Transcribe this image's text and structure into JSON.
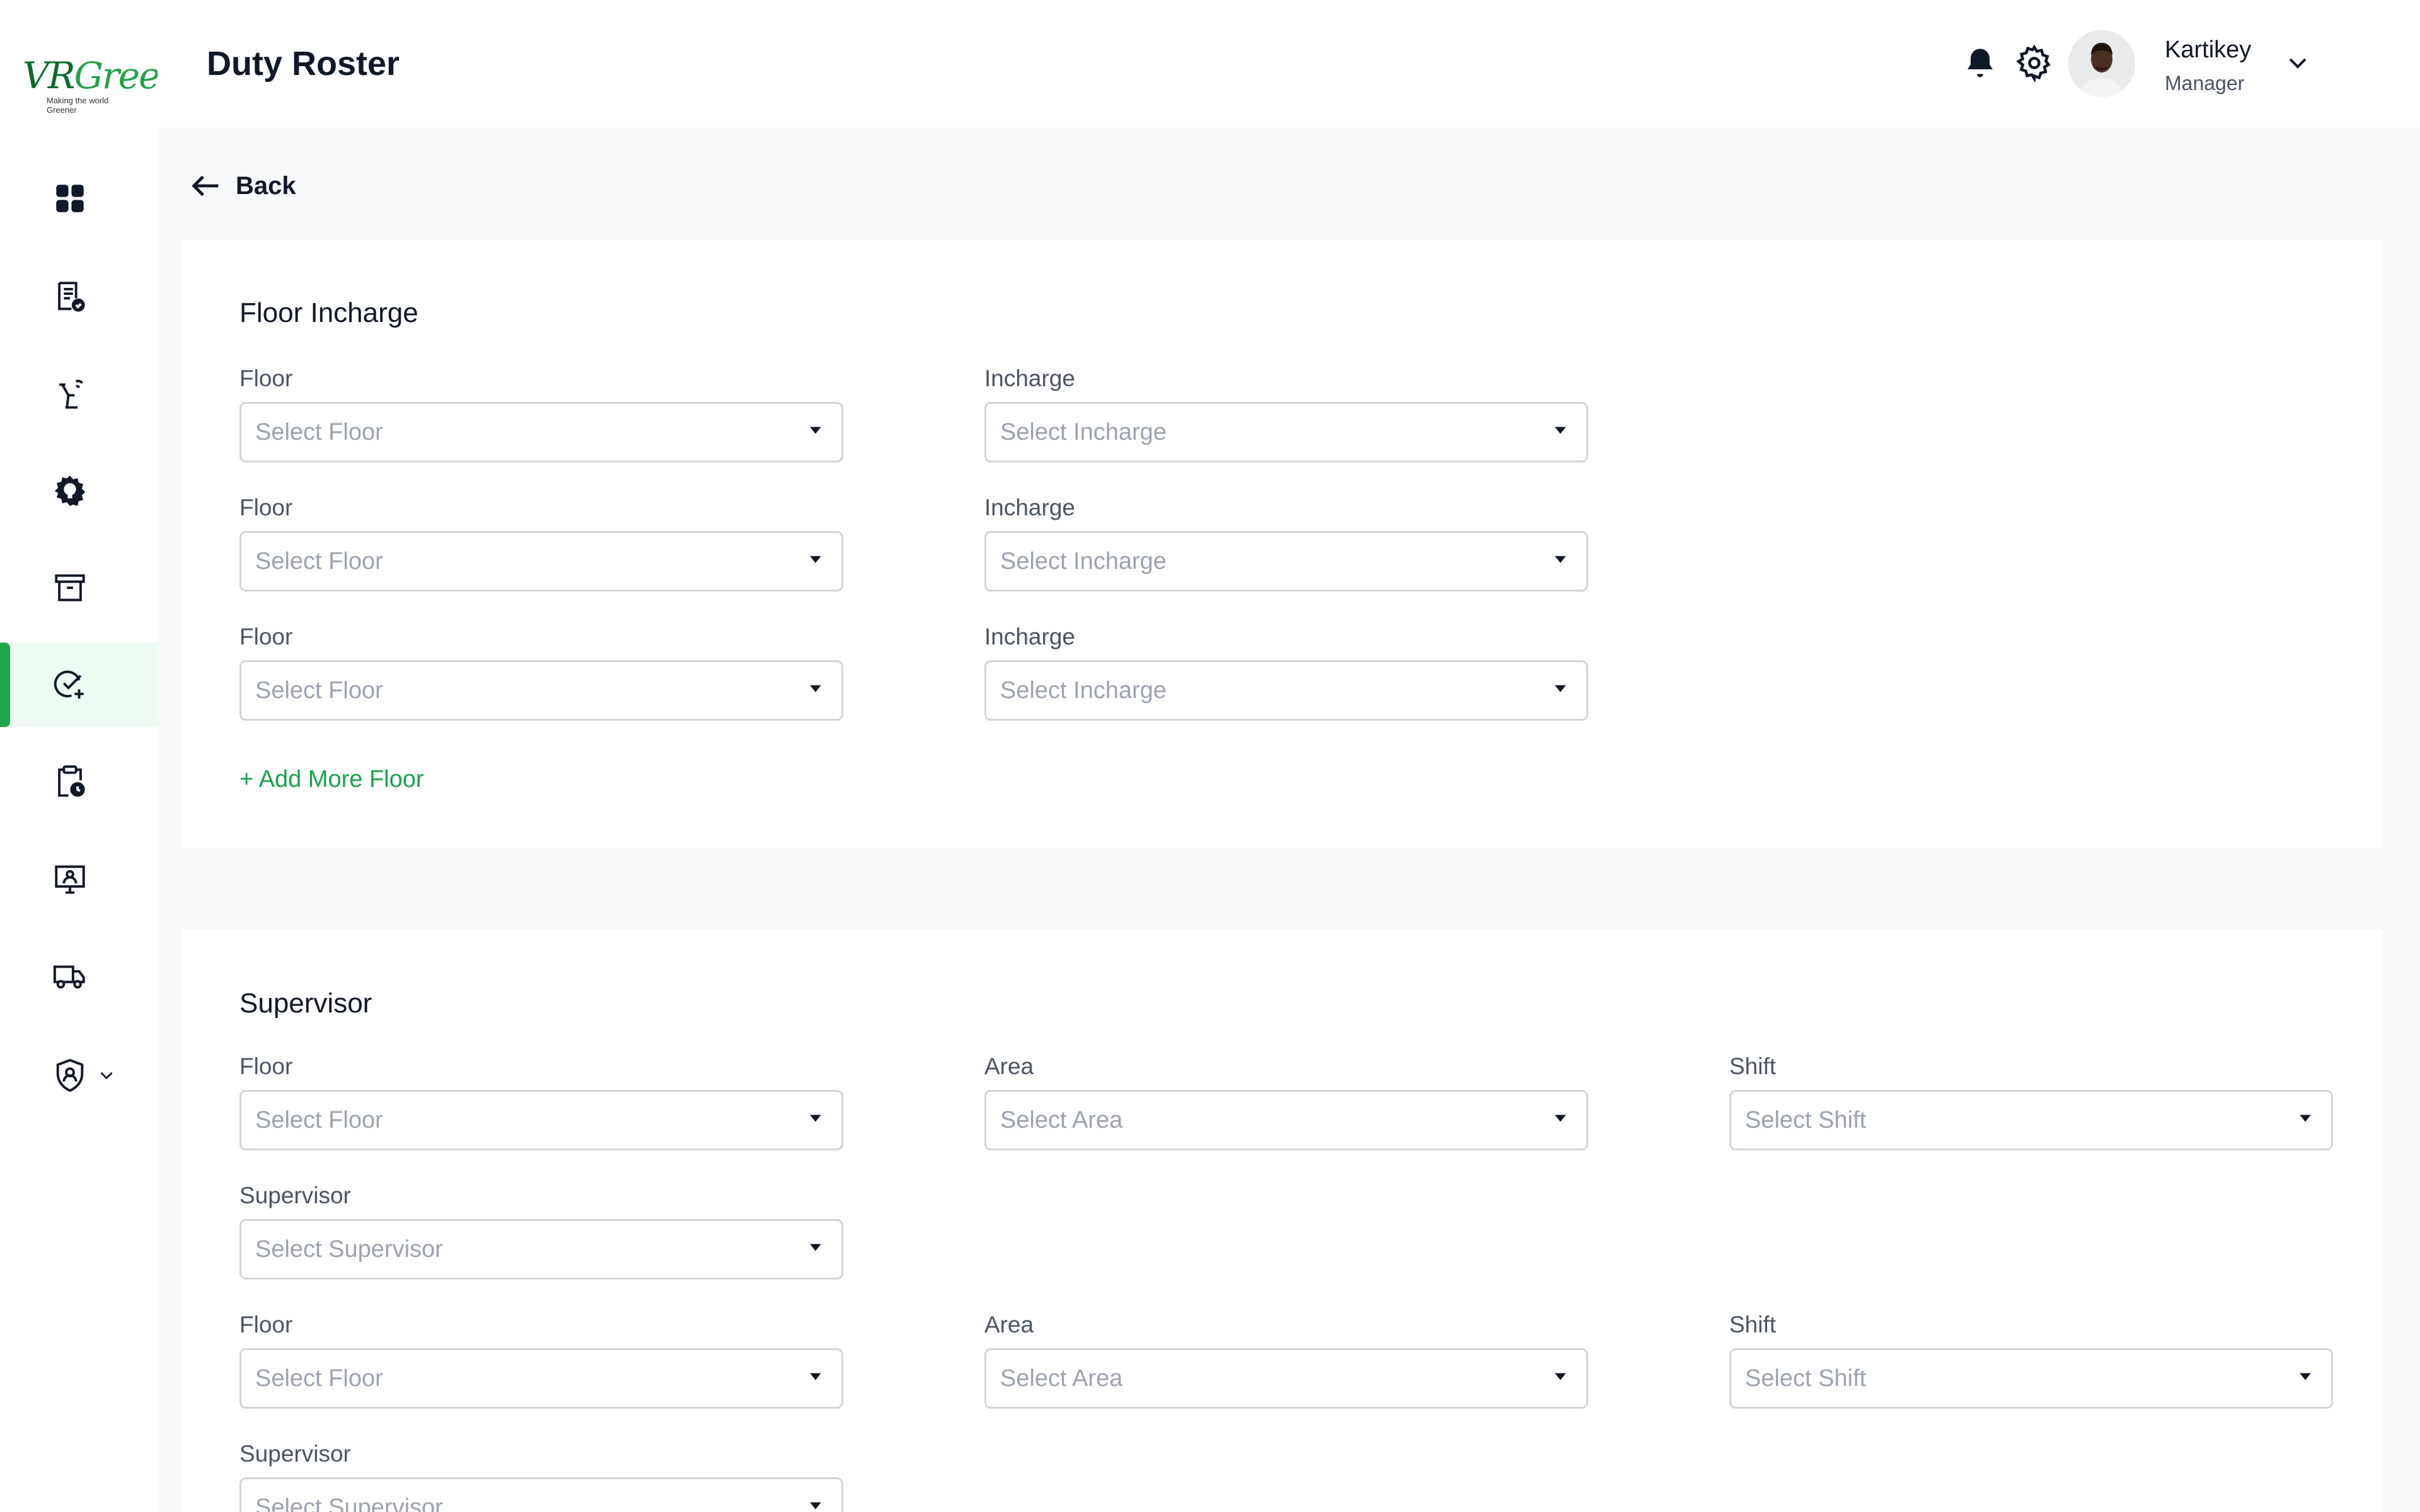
{
  "logo": {
    "brand_a": "VR",
    "brand_b": "Green",
    "tagline": "Making the world Greener"
  },
  "header": {
    "title": "Duty Roster",
    "user": {
      "name": "Kartikey",
      "role": "Manager"
    }
  },
  "back_label": "Back",
  "floor_incharge": {
    "title": "Floor Incharge",
    "floor_label": "Floor",
    "incharge_label": "Incharge",
    "floor_placeholder": "Select Floor",
    "incharge_placeholder": "Select Incharge",
    "add_more": "+ Add More Floor"
  },
  "supervisor": {
    "title": "Supervisor",
    "floor_label": "Floor",
    "area_label": "Area",
    "shift_label": "Shift",
    "supervisor_label": "Supervisor",
    "floor_placeholder": "Select Floor",
    "area_placeholder": "Select Area",
    "shift_placeholder": "Select Shift",
    "supervisor_placeholder": "Select Supervisor"
  },
  "colors": {
    "accent": "#16a34a",
    "active_bg": "#eefbf3",
    "page_bg": "#f8f9fb"
  },
  "sidebar_icons": [
    "dashboard-icon",
    "tasks-icon",
    "cleaning-icon",
    "settings-bulb-icon",
    "archive-icon",
    "check-add-icon",
    "clipboard-clock-icon",
    "monitor-user-icon",
    "truck-icon",
    "shield-user-icon"
  ]
}
